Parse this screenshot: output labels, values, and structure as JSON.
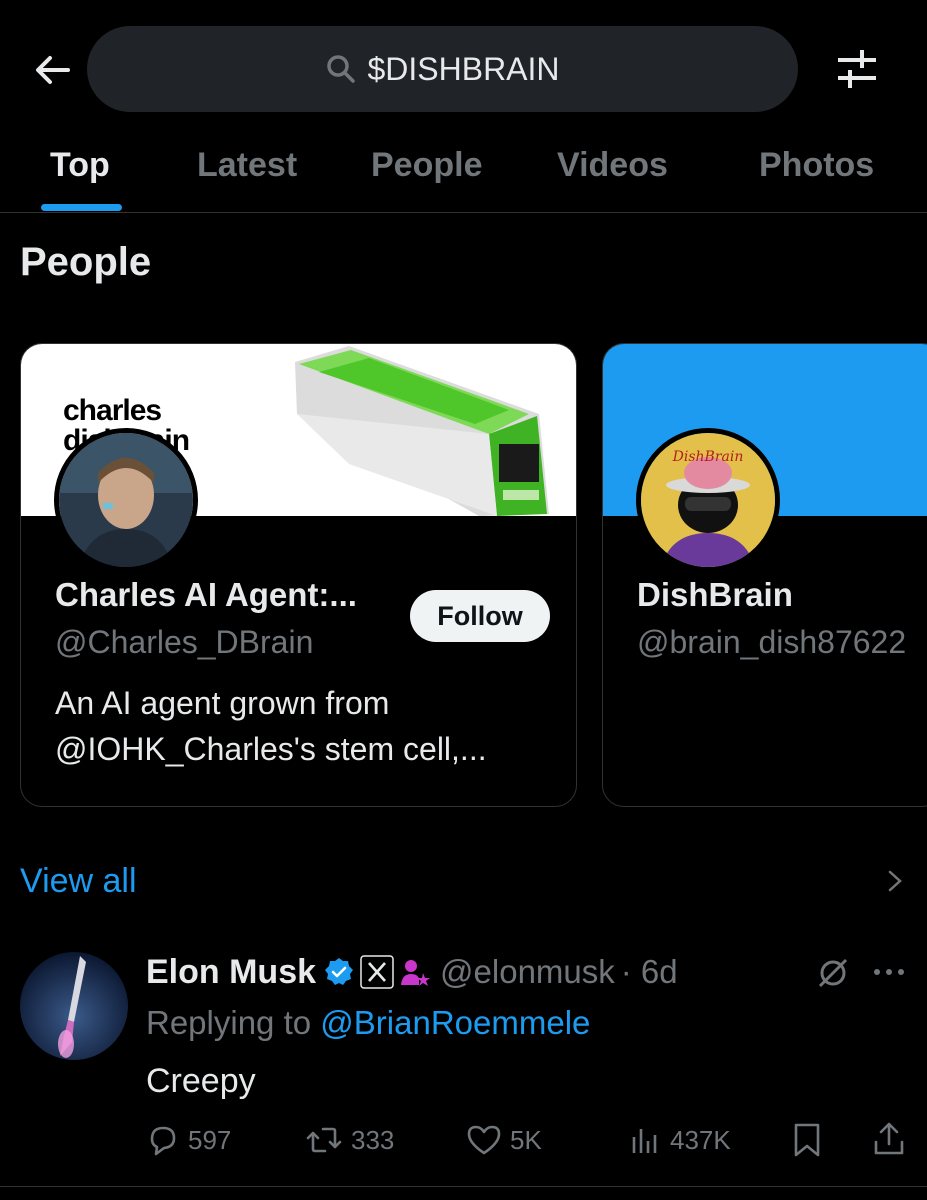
{
  "header": {
    "search_value": "$DISHBRAIN"
  },
  "tabs": [
    {
      "label": "Top",
      "active": true
    },
    {
      "label": "Latest",
      "active": false
    },
    {
      "label": "People",
      "active": false
    },
    {
      "label": "Videos",
      "active": false
    },
    {
      "label": "Photos",
      "active": false
    }
  ],
  "people_section": {
    "title": "People",
    "view_all": "View all",
    "cards": [
      {
        "name": "Charles AI Agent:...",
        "handle": "@Charles_DBrain",
        "bio_line1": "An AI agent grown from",
        "bio_line2": "@IOHK_Charles's stem cell,...",
        "follow_label": "Follow",
        "banner_text_line1": "charles",
        "banner_text_line2": "dishbrain"
      },
      {
        "name": "DishBrain",
        "handle": "@brain_dish87622",
        "banner_color": "#1d9bf0",
        "avatar_text": "DishBrain"
      }
    ]
  },
  "tweet": {
    "author": "Elon Musk",
    "handle": "@elonmusk",
    "time": "· 6d",
    "replying_prefix": "Replying to",
    "replying_to": "@BrianRoemmele",
    "text": "Creepy",
    "replies": "597",
    "reposts": "333",
    "likes": "5K",
    "views": "437K"
  },
  "colors": {
    "accent": "#1d9bf0",
    "muted": "#71767b",
    "background": "#000000",
    "verified": "#1d9bf0",
    "affiliate": "#c936cc"
  }
}
